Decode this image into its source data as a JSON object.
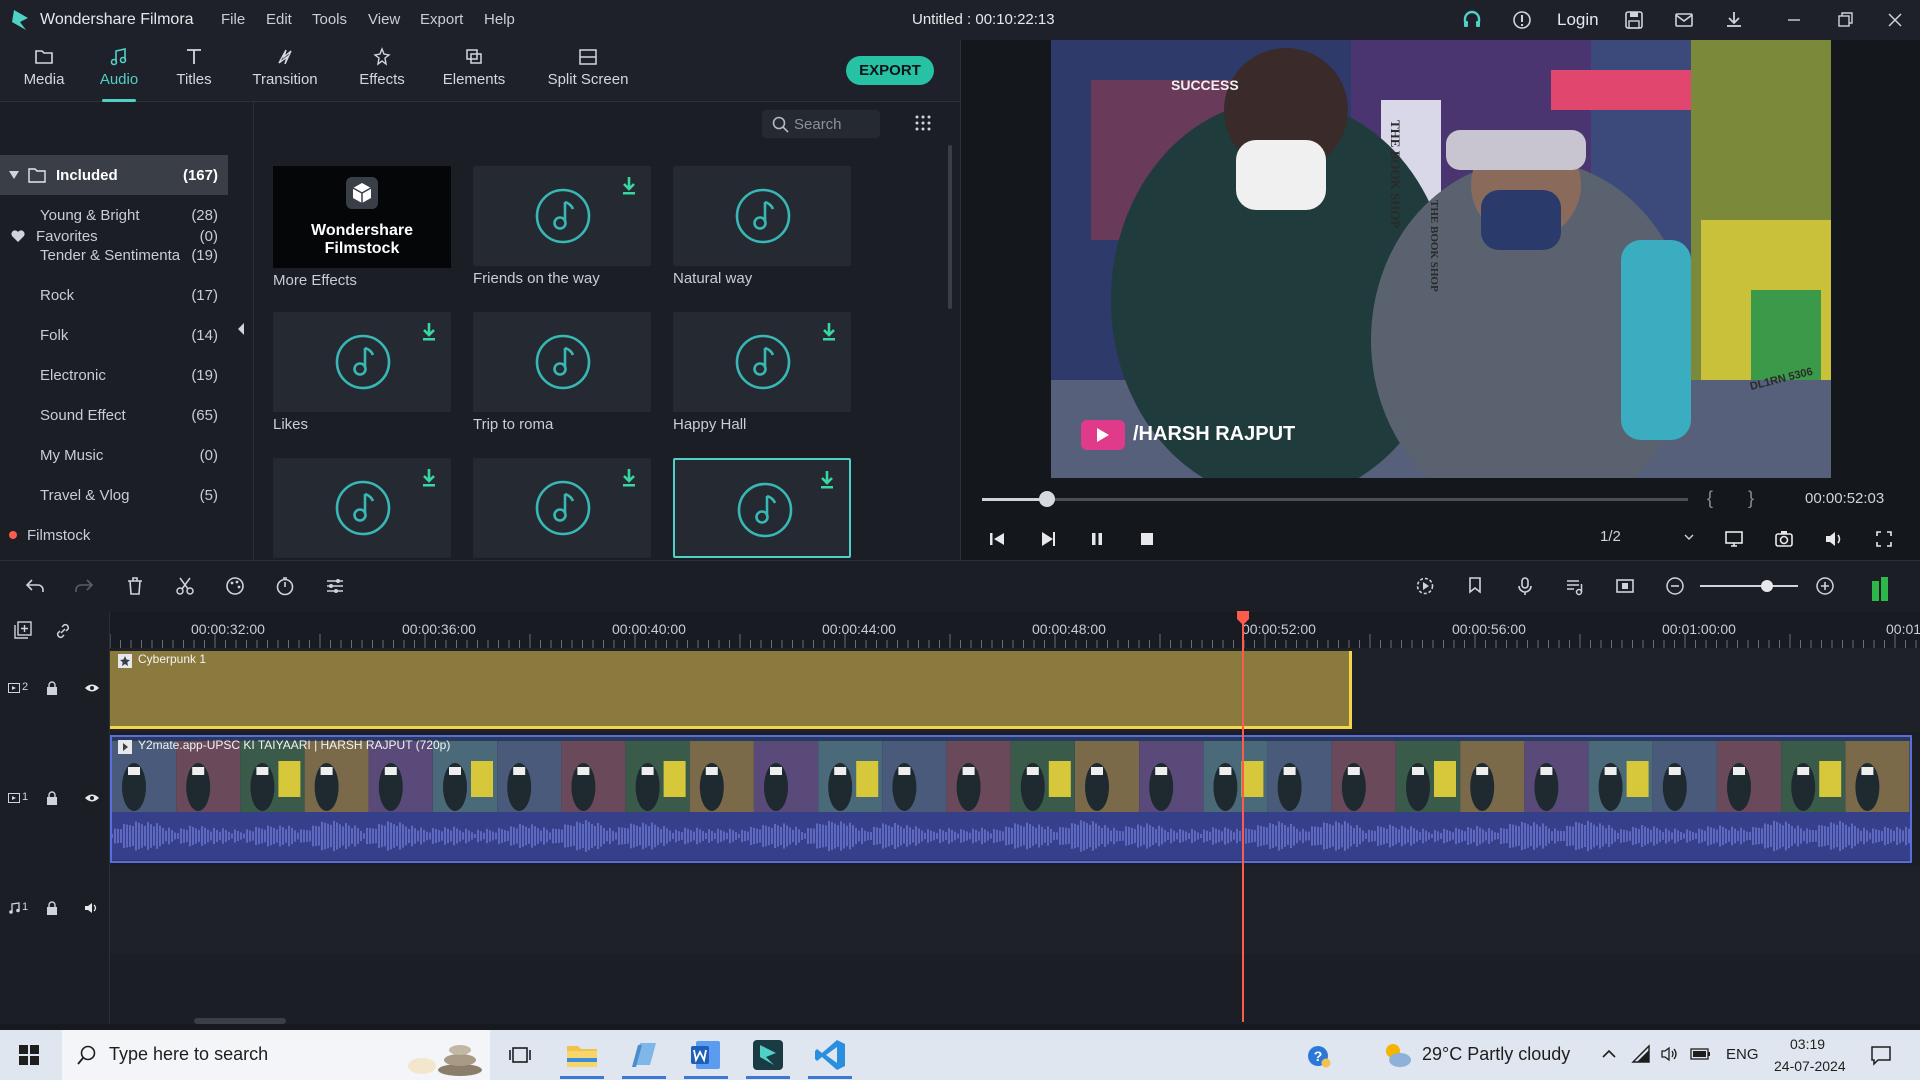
{
  "app": {
    "name": "Wondershare Filmora",
    "document_title": "Untitled : 00:10:22:13",
    "menu": [
      "File",
      "Edit",
      "Tools",
      "View",
      "Export",
      "Help"
    ],
    "login_label": "Login"
  },
  "toolbar": {
    "tabs": [
      {
        "label": "Media",
        "icon": "folder-icon"
      },
      {
        "label": "Audio",
        "icon": "music-note-icon",
        "active": true
      },
      {
        "label": "Titles",
        "icon": "text-t-icon"
      },
      {
        "label": "Transition",
        "icon": "transition-icon"
      },
      {
        "label": "Effects",
        "icon": "effects-icon"
      },
      {
        "label": "Elements",
        "icon": "elements-icon"
      },
      {
        "label": "Split Screen",
        "icon": "split-screen-icon"
      }
    ],
    "export_label": "EXPORT"
  },
  "library": {
    "items": [
      {
        "label": "Favorites",
        "count": "(0)"
      },
      {
        "label": "Included",
        "count": "(167)"
      },
      {
        "label": "Young & Bright",
        "count": "(28)"
      },
      {
        "label": "Tender & Sentimenta",
        "count": "(19)"
      },
      {
        "label": "Rock",
        "count": "(17)"
      },
      {
        "label": "Folk",
        "count": "(14)"
      },
      {
        "label": "Electronic",
        "count": "(19)"
      },
      {
        "label": "Sound Effect",
        "count": "(65)"
      },
      {
        "label": "My Music",
        "count": "(0)"
      },
      {
        "label": "Travel & Vlog",
        "count": "(5)"
      },
      {
        "label": "Filmstock",
        "count": ""
      }
    ]
  },
  "grid": {
    "search_placeholder": "Search",
    "filmstock_card": {
      "line1": "Wondershare",
      "line2": "Filmstock",
      "label": "More Effects"
    },
    "items": [
      {
        "label": "Friends on the way"
      },
      {
        "label": "Natural way"
      },
      {
        "label": "Likes"
      },
      {
        "label": "Trip to roma"
      },
      {
        "label": "Happy Hall"
      },
      {
        "label": ""
      },
      {
        "label": ""
      },
      {
        "label": ""
      }
    ]
  },
  "preview": {
    "overlay_text": "/HARSH RAJPUT",
    "timecode": "00:00:52:03",
    "progress": 0.08,
    "ratio": "1/2",
    "sign_texts": [
      "SUCCESS",
      "THE BOOK SHOP",
      "THE BOOK SHOP",
      "DL1RN 5306"
    ]
  },
  "timeline": {
    "ticks": [
      "00:00:32:00",
      "00:00:36:00",
      "00:00:40:00",
      "00:00:44:00",
      "00:00:48:00",
      "00:00:52:00",
      "00:00:56:00",
      "00:01:00:00",
      "00:01"
    ],
    "track_labels": [
      "2",
      "1",
      "1"
    ],
    "fx_clip_label": "Cyberpunk 1",
    "video_clip_label": "Y2mate.app-UPSC KI TAIYAARI | HARSH RAJPUT (720p)",
    "zoom_level": 0.7
  },
  "taskbar": {
    "search_placeholder": "Type here to search",
    "weather": "29°C  Partly cloudy",
    "lang": "ENG",
    "time": "03:19",
    "date": "24-07-2024"
  },
  "colors": {
    "accent": "#4fd1c5",
    "export": "#27c2a4",
    "playhead": "#ff5a4e",
    "fx_clip": "#8b7a3e",
    "fx_border": "#f5d44c",
    "video_border": "#5a6de0"
  }
}
